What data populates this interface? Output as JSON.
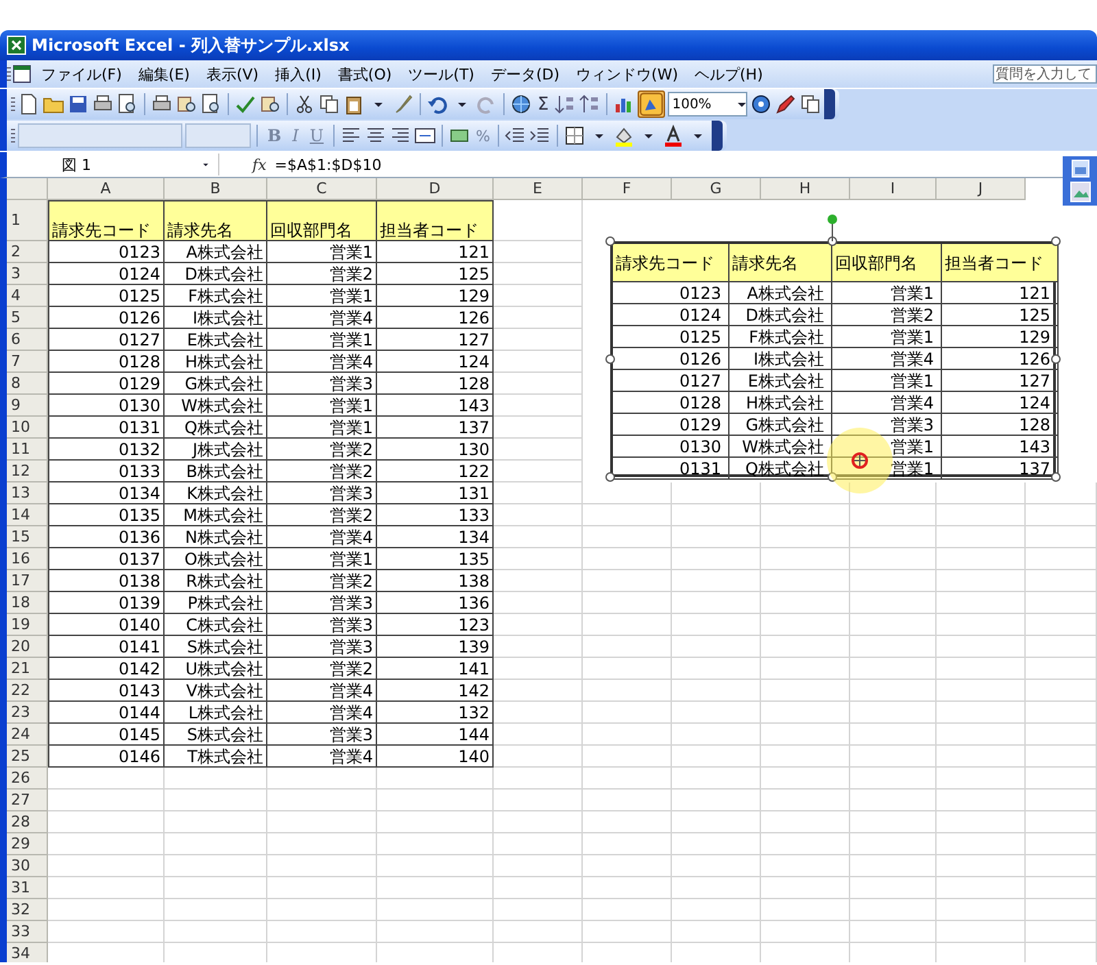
{
  "window": {
    "title": "Microsoft Excel - 列入替サンプル.xlsx"
  },
  "menu": [
    "ファイル(F)",
    "編集(E)",
    "表示(V)",
    "挿入(I)",
    "書式(O)",
    "ツール(T)",
    "データ(D)",
    "ウィンドウ(W)",
    "ヘルプ(H)"
  ],
  "help_box": {
    "placeholder": "質問を入力して"
  },
  "toolbar": {
    "sum": "Σ",
    "zoom": "100%"
  },
  "format_toolbar": {
    "styles": [
      "B",
      "I",
      "U"
    ],
    "percent": "%"
  },
  "formula_bar": {
    "name_box": "図 1",
    "function_label": "fx",
    "formula": "=$A$1:$D$10"
  },
  "sheet": {
    "columns": [
      "A",
      "B",
      "C",
      "D",
      "E",
      "F",
      "G",
      "H",
      "I",
      "J"
    ],
    "rows": [
      "1",
      "2",
      "3",
      "4",
      "5",
      "6",
      "7",
      "8",
      "9",
      "10",
      "11",
      "12",
      "13",
      "14",
      "15",
      "16",
      "17",
      "18",
      "19",
      "20",
      "21",
      "22",
      "23",
      "24",
      "25",
      "26",
      "27",
      "28",
      "29",
      "30",
      "31",
      "32",
      "33",
      "34"
    ],
    "header": [
      "請求先コード",
      "請求先名",
      "回収部門名",
      "担当者コード"
    ],
    "data": [
      [
        "0123",
        "A株式会社",
        "営業1",
        "121"
      ],
      [
        "0124",
        "D株式会社",
        "営業2",
        "125"
      ],
      [
        "0125",
        "F株式会社",
        "営業1",
        "129"
      ],
      [
        "0126",
        "I株式会社",
        "営業4",
        "126"
      ],
      [
        "0127",
        "E株式会社",
        "営業1",
        "127"
      ],
      [
        "0128",
        "H株式会社",
        "営業4",
        "124"
      ],
      [
        "0129",
        "G株式会社",
        "営業3",
        "128"
      ],
      [
        "0130",
        "W株式会社",
        "営業1",
        "143"
      ],
      [
        "0131",
        "Q株式会社",
        "営業1",
        "137"
      ],
      [
        "0132",
        "J株式会社",
        "営業2",
        "130"
      ],
      [
        "0133",
        "B株式会社",
        "営業2",
        "122"
      ],
      [
        "0134",
        "K株式会社",
        "営業3",
        "131"
      ],
      [
        "0135",
        "M株式会社",
        "営業2",
        "133"
      ],
      [
        "0136",
        "N株式会社",
        "営業4",
        "134"
      ],
      [
        "0137",
        "O株式会社",
        "営業1",
        "135"
      ],
      [
        "0138",
        "R株式会社",
        "営業2",
        "138"
      ],
      [
        "0139",
        "P株式会社",
        "営業3",
        "136"
      ],
      [
        "0140",
        "C株式会社",
        "営業3",
        "123"
      ],
      [
        "0141",
        "S株式会社",
        "営業3",
        "139"
      ],
      [
        "0142",
        "U株式会社",
        "営業2",
        "141"
      ],
      [
        "0143",
        "V株式会社",
        "営業4",
        "142"
      ],
      [
        "0144",
        "L株式会社",
        "営業4",
        "132"
      ],
      [
        "0145",
        "S株式会社",
        "営業3",
        "144"
      ],
      [
        "0146",
        "T株式会社",
        "営業4",
        "140"
      ]
    ]
  },
  "picture": {
    "header": [
      "請求先コード",
      "請求先名",
      "回収部門名",
      "担当者コード"
    ],
    "data": [
      [
        "0123",
        "A株式会社",
        "営業1",
        "121"
      ],
      [
        "0124",
        "D株式会社",
        "営業2",
        "125"
      ],
      [
        "0125",
        "F株式会社",
        "営業1",
        "129"
      ],
      [
        "0126",
        "I株式会社",
        "営業4",
        "126"
      ],
      [
        "0127",
        "E株式会社",
        "営業1",
        "127"
      ],
      [
        "0128",
        "H株式会社",
        "営業4",
        "124"
      ],
      [
        "0129",
        "G株式会社",
        "営業3",
        "128"
      ],
      [
        "0130",
        "W株式会社",
        "営業1",
        "143"
      ],
      [
        "0131",
        "Q株式会社",
        "営業1",
        "137"
      ]
    ]
  }
}
